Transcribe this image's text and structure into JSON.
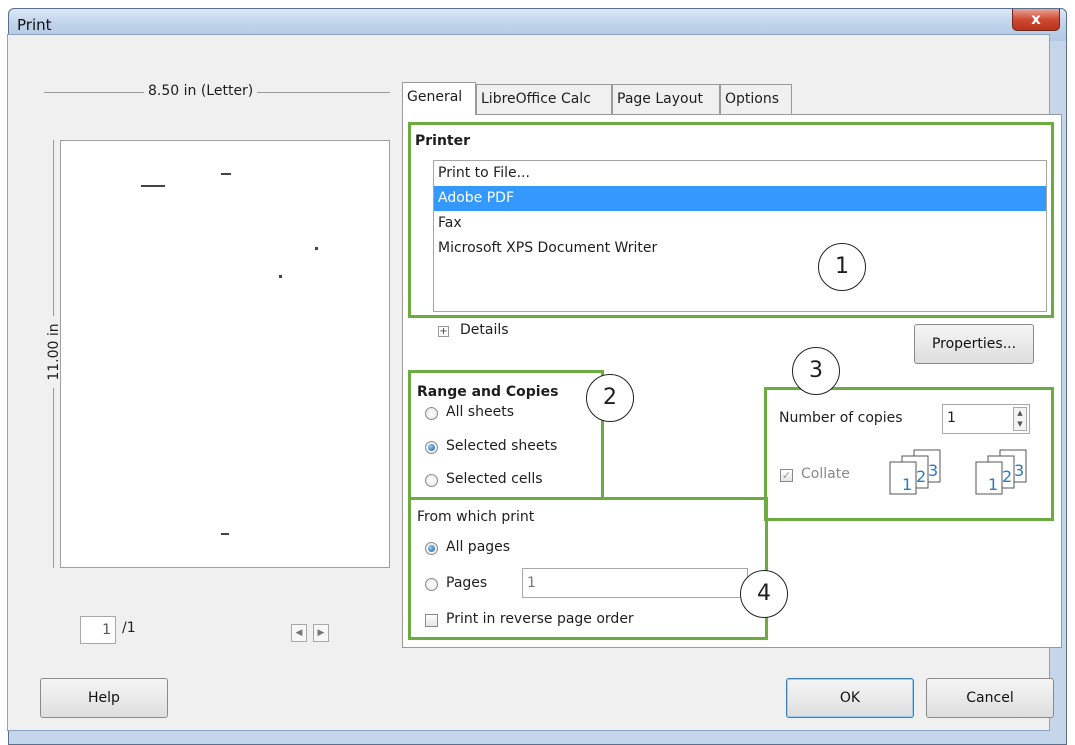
{
  "window": {
    "title": "Print",
    "close_glyph": "x"
  },
  "preview": {
    "width_label": "8.50 in (Letter)",
    "height_label": "11.00 in",
    "current_page": "1",
    "total_pages": "/1"
  },
  "tabs": [
    {
      "label": "General",
      "active": true
    },
    {
      "label": "LibreOffice Calc",
      "active": false
    },
    {
      "label": "Page Layout",
      "active": false
    },
    {
      "label": "Options",
      "active": false
    }
  ],
  "printer": {
    "group_title": "Printer",
    "items": [
      "Print to File...",
      "Adobe PDF",
      "Fax",
      "Microsoft XPS Document Writer"
    ],
    "selected": "Adobe PDF",
    "details_label": "Details",
    "properties_button": "Properties..."
  },
  "range": {
    "group_title": "Range and Copies",
    "options": [
      "All sheets",
      "Selected sheets",
      "Selected cells"
    ],
    "selected": "Selected sheets"
  },
  "copies": {
    "label": "Number of copies",
    "value": "1",
    "collate_label": "Collate",
    "collate_checked": true,
    "collate_enabled": false
  },
  "print_from": {
    "group_title": "From which print",
    "options": [
      "All pages",
      "Pages"
    ],
    "selected": "All pages",
    "pages_value": "1",
    "reverse_label": "Print in reverse page order",
    "reverse_checked": false
  },
  "callouts": [
    "1",
    "2",
    "3",
    "4"
  ],
  "buttons": {
    "help": "Help",
    "ok": "OK",
    "cancel": "Cancel"
  },
  "colors": {
    "highlight": "#6bab3f",
    "selection": "#3399ff"
  }
}
